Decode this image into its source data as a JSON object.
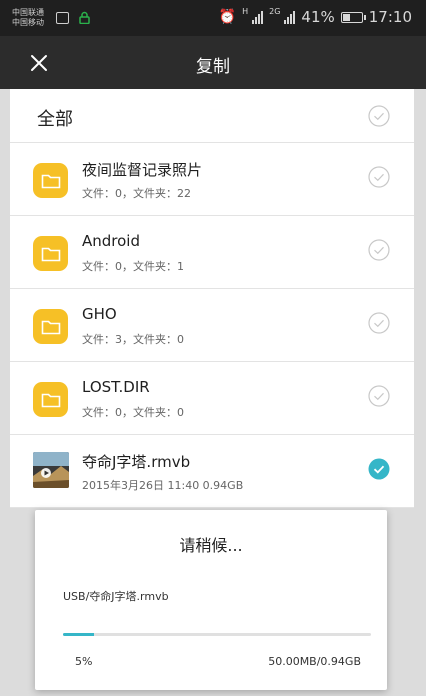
{
  "status_bar": {
    "carrier_line1": "中国联通",
    "carrier_line2": "中国移动",
    "network1": "H",
    "network2": "2G",
    "battery": "41%",
    "time": "17:10",
    "icons": [
      "image-icon",
      "lock-icon",
      "alarm-icon",
      "signal-icon",
      "battery-icon"
    ]
  },
  "header": {
    "close_icon": "close-icon",
    "title": "复制"
  },
  "list": {
    "all_label": "全部",
    "items": [
      {
        "name": "夜间监督记录照片",
        "meta": "文件：0，文件夹：22",
        "type": "folder",
        "checked": false
      },
      {
        "name": "Android",
        "meta": "文件：0，文件夹：1",
        "type": "folder",
        "checked": false
      },
      {
        "name": "GHO",
        "meta": "文件：3，文件夹：0",
        "type": "folder",
        "checked": false
      },
      {
        "name": "LOST.DIR",
        "meta": "文件：0，文件夹：0",
        "type": "folder",
        "checked": false
      },
      {
        "name": "夺命J字塔.rmvb",
        "meta": "2015年3月26日 11:40 0.94GB",
        "type": "video",
        "checked": true
      }
    ]
  },
  "dialog": {
    "title": "请稍候...",
    "file_path": "USB/夺命J字塔.rmvb",
    "progress_percent": 5,
    "percent_label": "5%",
    "size_label": "50.00MB/0.94GB"
  },
  "colors": {
    "accent": "#35b6c8",
    "folder": "#f6c026",
    "title_bar": "#2c2c2c",
    "status_bar": "#1f1f1f"
  }
}
